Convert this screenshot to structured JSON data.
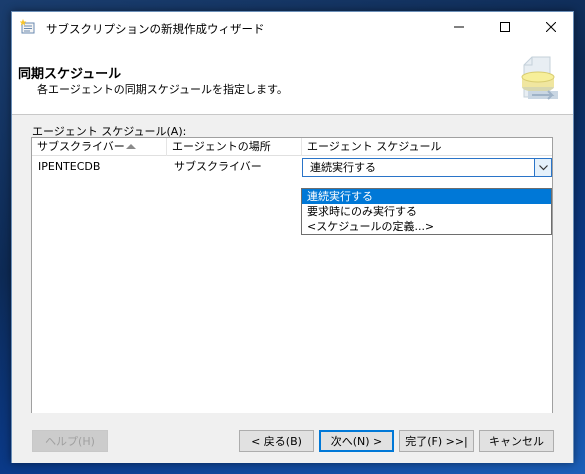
{
  "window": {
    "title": "サブスクリプションの新規作成ウィザード",
    "minimize": "—",
    "maximize": "☐",
    "close": "✕"
  },
  "header": {
    "title": "同期スケジュール",
    "subtitle": "各エージェントの同期スケジュールを指定します。"
  },
  "grid": {
    "label": "エージェント スケジュール(A):",
    "columns": [
      "サブスクライバー",
      "エージェントの場所",
      "エージェント スケジュール"
    ],
    "sort_column": "サブスクライバー",
    "rows": [
      {
        "subscriber": "IPENTECDB",
        "location": "サブスクライバー",
        "schedule": "連続実行する"
      }
    ]
  },
  "dropdown": {
    "options": [
      "連続実行する",
      "要求時にのみ実行する",
      "<スケジュールの定義...>"
    ],
    "selected": "連続実行する"
  },
  "buttons": {
    "help": "ヘルプ(H)",
    "back": "< 戻る(B)",
    "next": "次へ(N) >",
    "finish": "完了(F) >>|",
    "cancel": "キャンセル"
  },
  "colors": {
    "selection": "#0078d7",
    "focus_border": "#2a74c8"
  }
}
